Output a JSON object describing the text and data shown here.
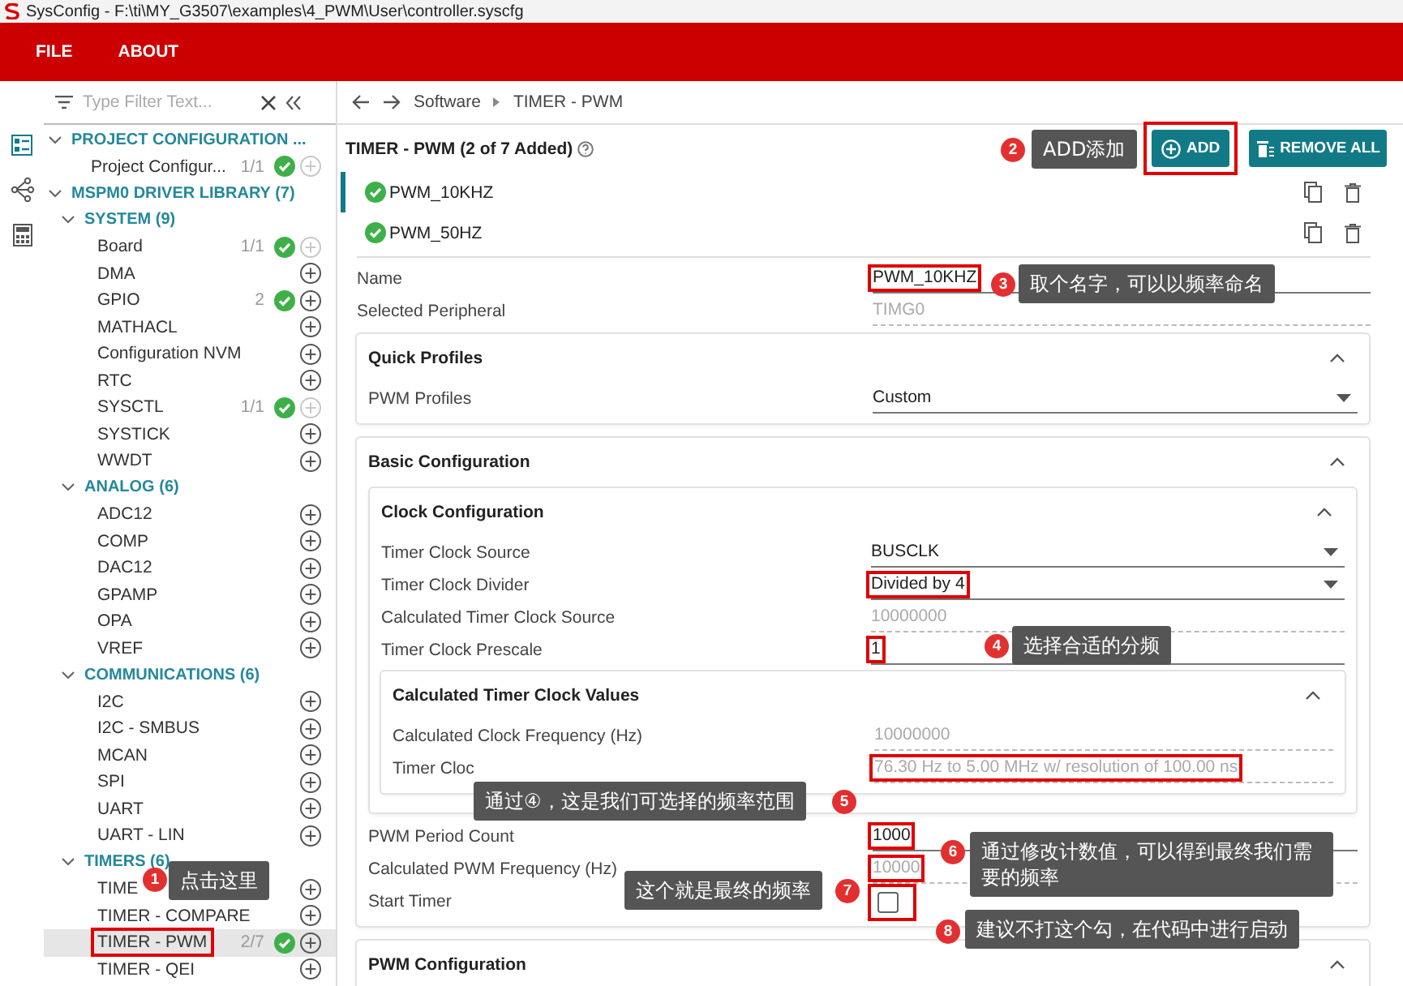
{
  "title_bar": {
    "title": "SysConfig - F:\\ti\\MY_G3507\\examples\\4_PWM\\User\\controller.syscfg"
  },
  "menu": [
    "FILE",
    "ABOUT"
  ],
  "filter": {
    "placeholder": "Type Filter Text..."
  },
  "tree": [
    {
      "kind": "group",
      "label": "PROJECT CONFIGURATION ...",
      "expanded": true,
      "children": [
        {
          "kind": "item",
          "label": "Project Configur...",
          "count": "1/1",
          "added": true,
          "add_enabled": false,
          "selected": false,
          "highlighted": false
        }
      ]
    },
    {
      "kind": "group",
      "label": "MSPM0 DRIVER LIBRARY (7)",
      "expanded": true,
      "children": [
        {
          "kind": "group",
          "label": "SYSTEM (9)",
          "expanded": true,
          "children": [
            {
              "kind": "item",
              "label": "Board",
              "count": "1/1",
              "added": true,
              "add_enabled": false,
              "selected": false,
              "highlighted": false
            },
            {
              "kind": "item",
              "label": "DMA",
              "added": false,
              "add_enabled": true,
              "selected": false,
              "highlighted": false
            },
            {
              "kind": "item",
              "label": "GPIO",
              "count": "2",
              "added": true,
              "add_enabled": true,
              "selected": false,
              "highlighted": false
            },
            {
              "kind": "item",
              "label": "MATHACL",
              "added": false,
              "add_enabled": true,
              "selected": false,
              "highlighted": false
            },
            {
              "kind": "item",
              "label": "Configuration NVM",
              "added": false,
              "add_enabled": true,
              "selected": false,
              "highlighted": false
            },
            {
              "kind": "item",
              "label": "RTC",
              "added": false,
              "add_enabled": true,
              "selected": false,
              "highlighted": false
            },
            {
              "kind": "item",
              "label": "SYSCTL",
              "count": "1/1",
              "added": true,
              "add_enabled": false,
              "selected": false,
              "highlighted": false
            },
            {
              "kind": "item",
              "label": "SYSTICK",
              "added": false,
              "add_enabled": true,
              "selected": false,
              "highlighted": false
            },
            {
              "kind": "item",
              "label": "WWDT",
              "added": false,
              "add_enabled": true,
              "selected": false,
              "highlighted": false
            }
          ]
        },
        {
          "kind": "group",
          "label": "ANALOG (6)",
          "expanded": true,
          "children": [
            {
              "kind": "item",
              "label": "ADC12",
              "added": false,
              "add_enabled": true,
              "selected": false,
              "highlighted": false
            },
            {
              "kind": "item",
              "label": "COMP",
              "added": false,
              "add_enabled": true,
              "selected": false,
              "highlighted": false
            },
            {
              "kind": "item",
              "label": "DAC12",
              "added": false,
              "add_enabled": true,
              "selected": false,
              "highlighted": false
            },
            {
              "kind": "item",
              "label": "GPAMP",
              "added": false,
              "add_enabled": true,
              "selected": false,
              "highlighted": false
            },
            {
              "kind": "item",
              "label": "OPA",
              "added": false,
              "add_enabled": true,
              "selected": false,
              "highlighted": false
            },
            {
              "kind": "item",
              "label": "VREF",
              "added": false,
              "add_enabled": true,
              "selected": false,
              "highlighted": false
            }
          ]
        },
        {
          "kind": "group",
          "label": "COMMUNICATIONS (6)",
          "expanded": true,
          "children": [
            {
              "kind": "item",
              "label": "I2C",
              "added": false,
              "add_enabled": true,
              "selected": false,
              "highlighted": false
            },
            {
              "kind": "item",
              "label": "I2C - SMBUS",
              "added": false,
              "add_enabled": true,
              "selected": false,
              "highlighted": false
            },
            {
              "kind": "item",
              "label": "MCAN",
              "added": false,
              "add_enabled": true,
              "selected": false,
              "highlighted": false
            },
            {
              "kind": "item",
              "label": "SPI",
              "added": false,
              "add_enabled": true,
              "selected": false,
              "highlighted": false
            },
            {
              "kind": "item",
              "label": "UART",
              "added": false,
              "add_enabled": true,
              "selected": false,
              "highlighted": false
            },
            {
              "kind": "item",
              "label": "UART - LIN",
              "added": false,
              "add_enabled": true,
              "selected": false,
              "highlighted": false
            }
          ]
        },
        {
          "kind": "group",
          "label": "TIMERS (6)",
          "expanded": true,
          "children": [
            {
              "kind": "item",
              "label": "TIME",
              "added": false,
              "add_enabled": true,
              "selected": false,
              "highlighted": false
            },
            {
              "kind": "item",
              "label": "TIMER - COMPARE",
              "added": false,
              "add_enabled": true,
              "selected": false,
              "highlighted": false
            },
            {
              "kind": "item",
              "label": "TIMER - PWM",
              "count": "2/7",
              "added": true,
              "add_enabled": true,
              "selected": true,
              "highlighted": true
            },
            {
              "kind": "item",
              "label": "TIMER - QEI",
              "added": false,
              "add_enabled": true,
              "selected": false,
              "highlighted": false
            }
          ]
        }
      ]
    }
  ],
  "breadcrumb": [
    "Software",
    "TIMER - PWM"
  ],
  "module": {
    "title": "TIMER - PWM (2 of 7 Added)",
    "add": "ADD",
    "add_highlighted": true,
    "remove_all": "REMOVE ALL"
  },
  "instances": [
    {
      "name": "PWM_10KHZ",
      "selected": true
    },
    {
      "name": "PWM_50HZ",
      "selected": false
    }
  ],
  "fields": [
    {
      "kind": "text",
      "label": "Name",
      "value": "PWM_10KHZ",
      "highlighted": true
    },
    {
      "kind": "readonly",
      "label": "Selected Peripheral",
      "value": "TIMG0",
      "highlighted": false
    }
  ],
  "cards": [
    {
      "title": "Quick Profiles",
      "expanded": true,
      "items": [
        {
          "kind": "select",
          "label": "PWM Profiles",
          "value": "Custom",
          "highlighted": false
        }
      ]
    },
    {
      "title": "Basic Configuration",
      "expanded": true,
      "items": [
        {
          "kind": "card",
          "title": "Clock Configuration",
          "expanded": true,
          "items": [
            {
              "kind": "select",
              "label": "Timer Clock Source",
              "value": "BUSCLK",
              "highlighted": false
            },
            {
              "kind": "select",
              "label": "Timer Clock Divider",
              "value": "Divided by 4",
              "highlighted": true
            },
            {
              "kind": "readonly",
              "label": "Calculated Timer Clock Source",
              "value": "10000000",
              "highlighted": false
            },
            {
              "kind": "text",
              "label": "Timer Clock Prescale",
              "value": "1",
              "highlighted": true
            },
            {
              "kind": "card",
              "title": "Calculated Timer Clock Values",
              "expanded": true,
              "items": [
                {
                  "kind": "readonly",
                  "label": "Calculated Clock Frequency (Hz)",
                  "value": "10000000",
                  "highlighted": false
                },
                {
                  "kind": "readonly",
                  "label": "Timer Cloc",
                  "value": "76.30 Hz to 5.00 MHz w/ resolution of 100.00 ns",
                  "highlighted": true
                }
              ]
            }
          ]
        },
        {
          "kind": "text",
          "label": "PWM Period Count",
          "value": "1000",
          "highlighted": true
        },
        {
          "kind": "readonly",
          "label": "Calculated PWM Frequency (Hz)",
          "value": "10000",
          "highlighted": true
        },
        {
          "kind": "checkbox",
          "label": "Start Timer",
          "checked": false,
          "highlighted": true
        }
      ]
    },
    {
      "title": "PWM Configuration",
      "expanded": true
    }
  ],
  "callouts": [
    {
      "number": "1",
      "text": "点击这里"
    },
    {
      "number": "2",
      "text": "ADD添加"
    },
    {
      "number": "3",
      "text": "取个名字，可以以频率命名"
    },
    {
      "number": "4",
      "text": "选择合适的分频"
    },
    {
      "number": "5",
      "text": "通过④，这是我们可选择的频率范围"
    },
    {
      "number": "6",
      "text": "通过修改计数值，可以得到最终我们需要的频率"
    },
    {
      "number": "7",
      "text": "这个就是最终的频率"
    },
    {
      "number": "8",
      "text": "建议不打这个勾，在代码中进行启动"
    }
  ]
}
